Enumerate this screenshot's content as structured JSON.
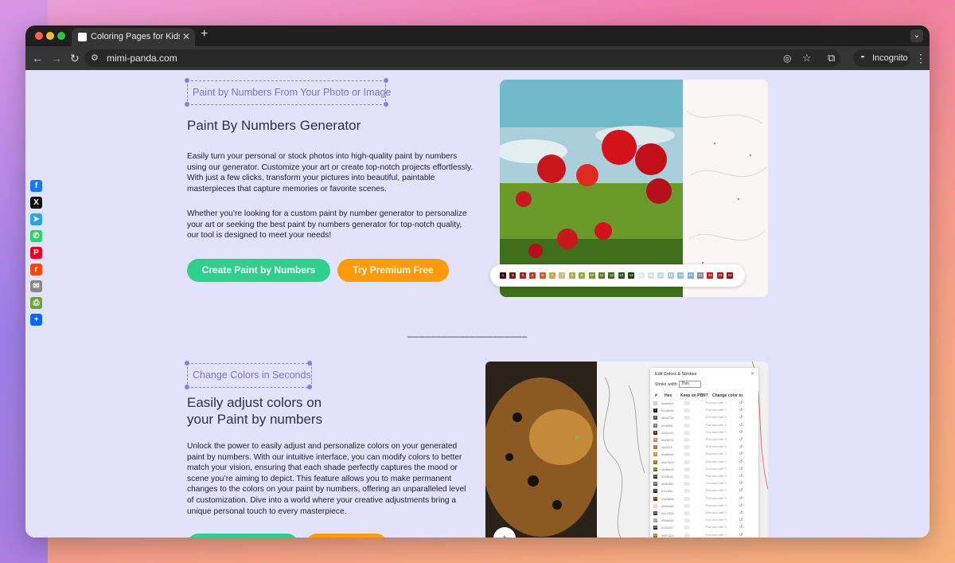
{
  "browser": {
    "tab_title": "Coloring Pages for Kids and A",
    "new_tab_symbol": "+",
    "url": "mimi-panda.com",
    "incognito_label": "Incognito"
  },
  "social_icons": [
    {
      "name": "facebook-icon",
      "glyph": "f",
      "color": "#1877f2"
    },
    {
      "name": "x-icon",
      "glyph": "X",
      "color": "#111111"
    },
    {
      "name": "telegram-icon",
      "glyph": "➤",
      "color": "#2aa3df"
    },
    {
      "name": "whatsapp-icon",
      "glyph": "✆",
      "color": "#25d366"
    },
    {
      "name": "pinterest-icon",
      "glyph": "P",
      "color": "#e60023"
    },
    {
      "name": "reddit-icon",
      "glyph": "r",
      "color": "#ff4500"
    },
    {
      "name": "email-icon",
      "glyph": "✉",
      "color": "#888888"
    },
    {
      "name": "print-icon",
      "glyph": "⎙",
      "color": "#6aa33b"
    },
    {
      "name": "share-icon",
      "glyph": "+",
      "color": "#0b66ff"
    }
  ],
  "section1": {
    "tag": "Paint by Numbers From Your Photo or Image",
    "title": "Paint By Numbers Generator",
    "para1": "Easily turn your personal or stock photos into high-quality paint by numbers using our generator. Customize your art or create top-notch projects effortlessly. With just a few clicks, transform your pictures into beautiful, paintable masterpieces that capture memories or favorite scenes.",
    "para2": "Whether you’re looking for a custom paint by number generator to personalize your art or seeking the best paint by numbers generator for top-notch quality, our tool is designed to meet your needs!",
    "btn_primary": "Create Paint by Numbers",
    "btn_secondary": "Try Premium Free"
  },
  "palette": [
    {
      "n": "1",
      "c": "#3a0c0c"
    },
    {
      "n": "2",
      "c": "#7a1a14"
    },
    {
      "n": "3",
      "c": "#a3261c"
    },
    {
      "n": "4",
      "c": "#c23b22"
    },
    {
      "n": "5",
      "c": "#d65a2f"
    },
    {
      "n": "6",
      "c": "#c9a24a"
    },
    {
      "n": "7",
      "c": "#c8c078"
    },
    {
      "n": "8",
      "c": "#a8b04a"
    },
    {
      "n": "9",
      "c": "#8fb03a"
    },
    {
      "n": "10",
      "c": "#6f9a24"
    },
    {
      "n": "11",
      "c": "#4f7f1c"
    },
    {
      "n": "12",
      "c": "#3a6a16"
    },
    {
      "n": "13",
      "c": "#2c5512"
    },
    {
      "n": "14",
      "c": "#1f3f0e"
    },
    {
      "n": "15",
      "c": "#e3eaea"
    },
    {
      "n": "16",
      "c": "#d3e1e4"
    },
    {
      "n": "17",
      "c": "#c6dbe0"
    },
    {
      "n": "18",
      "c": "#a9cdd6"
    },
    {
      "n": "19",
      "c": "#8fc2cf"
    },
    {
      "n": "20",
      "c": "#6fb6c8"
    },
    {
      "n": "21",
      "c": "#8a8a8a"
    },
    {
      "n": "22",
      "c": "#d3121a"
    },
    {
      "n": "23",
      "c": "#c10f18"
    },
    {
      "n": "24",
      "c": "#9a0c14"
    }
  ],
  "divider": "_____________________",
  "section2": {
    "tag": "Change Colors in Seconds",
    "title_line1": "Easily adjust colors on",
    "title_line2": "your Paint by numbers",
    "para": "Unlock the power to easily adjust and personalize colors on your generated paint by numbers. With our intuitive interface, you can modify colors to better match your vision, ensuring that each shade perfectly captures the mood or scene you’re aiming to depict. This feature allows you to make permanent changes to the colors on your paint by numbers, offering an unparalleled level of customization. Dive into a world where your creative adjustments bring a unique personal touch to every masterpiece."
  },
  "edit_panel": {
    "title": "Edit Colors & Strokes",
    "stroke_label": "Stroke width:",
    "stroke_value": "Thin",
    "headers": [
      "#",
      "Hex",
      "Keep on PBN?",
      "Change color to"
    ],
    "rows": [
      {
        "n": "1",
        "hex": "#eac0c4",
        "c": "#eac0c4"
      },
      {
        "n": "2",
        "hex": "#10de0b",
        "c": "#101010"
      },
      {
        "n": "3",
        "hex": "#63473e",
        "c": "#63473e"
      },
      {
        "n": "4",
        "hex": "#9d6f56",
        "c": "#9d6f56"
      },
      {
        "n": "5",
        "hex": "#3d2c20",
        "c": "#3d2c20"
      },
      {
        "n": "6",
        "hex": "#c48070",
        "c": "#c48070"
      },
      {
        "n": "7",
        "hex": "#b0324",
        "c": "#b07030"
      },
      {
        "n": "8",
        "hex": "#ca8e40",
        "c": "#ca8e40"
      },
      {
        "n": "9",
        "hex": "#8e7613",
        "c": "#8e7613"
      },
      {
        "n": "10",
        "hex": "#5d6e20",
        "c": "#5d6e20"
      },
      {
        "n": "11",
        "hex": "#2f3b16",
        "c": "#2f3b16"
      },
      {
        "n": "12",
        "hex": "#586360",
        "c": "#586360"
      },
      {
        "n": "13",
        "hex": "#1f1d0b",
        "c": "#1f1d0b"
      },
      {
        "n": "14",
        "hex": "#3d3b06",
        "c": "#3d3b06"
      },
      {
        "n": "15",
        "hex": "#d4d4d6",
        "c": "#d4d4d6"
      },
      {
        "n": "16",
        "hex": "#612325",
        "c": "#612325"
      },
      {
        "n": "17",
        "hex": "#95a0a2",
        "c": "#95a0a2"
      },
      {
        "n": "18",
        "hex": "#133337",
        "c": "#133337"
      },
      {
        "n": "19",
        "hex": "#957322",
        "c": "#957322"
      },
      {
        "n": "20",
        "hex": "#240330",
        "c": "#240330"
      }
    ],
    "row_placeholder": "Pick color with ✎"
  }
}
